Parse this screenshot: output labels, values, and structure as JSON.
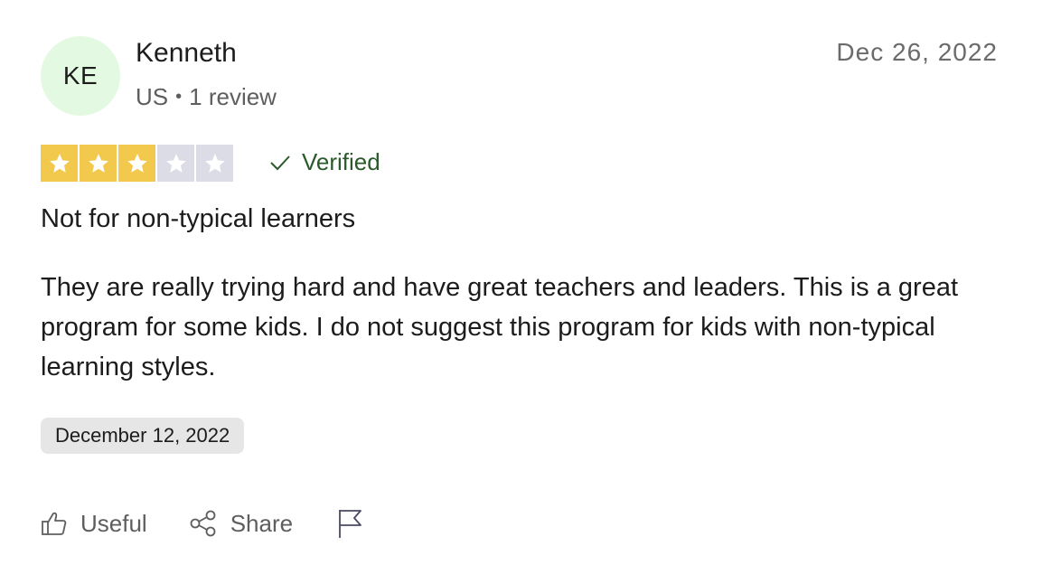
{
  "reviewer": {
    "initials": "KE",
    "name": "Kenneth",
    "country": "US",
    "separator": "•",
    "review_count": "1 review"
  },
  "review": {
    "date": "Dec 26, 2022",
    "rating": 3,
    "max_rating": 5,
    "verified_label": "Verified",
    "title": "Not for non-typical learners",
    "body": "They are really trying hard and have great teachers and leaders. This is a great program for some kids. I do not suggest this program for kids with non-typical learning styles.",
    "experience_date": "December 12, 2022"
  },
  "actions": {
    "useful_label": "Useful",
    "share_label": "Share"
  },
  "colors": {
    "avatar_bg": "#e3f9e1",
    "star_filled": "#f2c94c",
    "star_empty": "#dcdce6",
    "verified": "#2a5a2a"
  },
  "icons": {
    "star": "star-icon",
    "verified": "check-icon",
    "useful": "thumbs-up-icon",
    "share": "share-icon",
    "report": "flag-icon"
  }
}
